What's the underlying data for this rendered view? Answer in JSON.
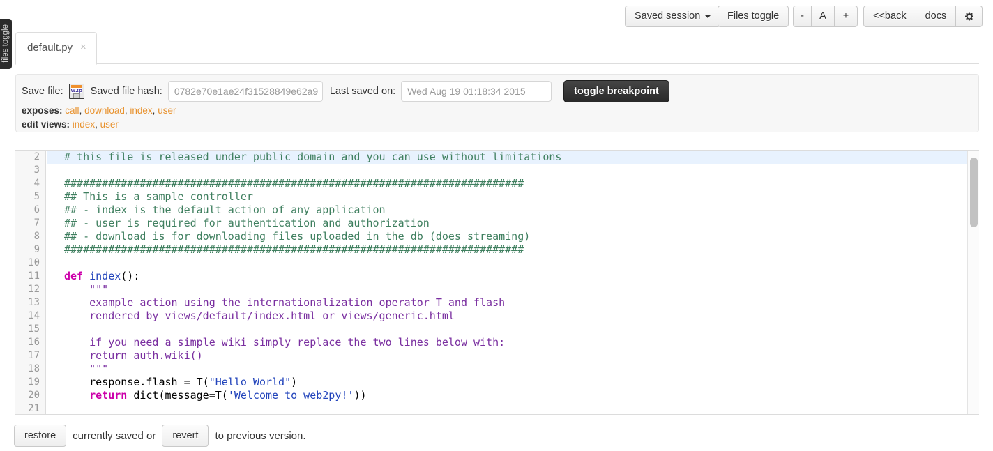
{
  "toolbar": {
    "saved_session": "Saved session",
    "files_toggle": "Files toggle",
    "zoom_out": "-",
    "font": "A",
    "zoom_in": "+",
    "back": "<<back",
    "docs": "docs",
    "settings_icon": "gear-icon"
  },
  "sidebar": {
    "files_toggle_label": "files toggle"
  },
  "tabs": [
    {
      "label": "default.py",
      "close": "×",
      "active": true
    }
  ],
  "info": {
    "save_file_label": "Save file:",
    "save_icon": "floppy-disk-icon",
    "save_icon_text": "w2p",
    "hash_label": "Saved file hash:",
    "hash_value": "0782e70e1ae24f31528849e62a9",
    "last_saved_label": "Last saved on:",
    "last_saved_value": "Wed Aug 19 01:18:34 2015",
    "toggle_breakpoint": "toggle breakpoint",
    "exposes_label": "exposes:",
    "exposes_links": [
      "call",
      "download",
      "index",
      "user"
    ],
    "edit_views_label": "edit views:",
    "edit_views_links": [
      "index",
      "user"
    ]
  },
  "editor": {
    "first_line_number": 2,
    "lines": [
      {
        "n": 2,
        "active": true,
        "clipped": true,
        "tokens": [
          {
            "t": "comment",
            "s": "# this file is released under public domain and you can use without limitations"
          }
        ]
      },
      {
        "n": 3,
        "tokens": []
      },
      {
        "n": 4,
        "tokens": [
          {
            "t": "comment",
            "s": "#########################################################################"
          }
        ]
      },
      {
        "n": 5,
        "tokens": [
          {
            "t": "comment",
            "s": "## This is a sample controller"
          }
        ]
      },
      {
        "n": 6,
        "tokens": [
          {
            "t": "comment",
            "s": "## - index is the default action of any application"
          }
        ]
      },
      {
        "n": 7,
        "tokens": [
          {
            "t": "comment",
            "s": "## - user is required for authentication and authorization"
          }
        ]
      },
      {
        "n": 8,
        "tokens": [
          {
            "t": "comment",
            "s": "## - download is for downloading files uploaded in the db (does streaming)"
          }
        ]
      },
      {
        "n": 9,
        "tokens": [
          {
            "t": "comment",
            "s": "#########################################################################"
          }
        ]
      },
      {
        "n": 10,
        "tokens": []
      },
      {
        "n": 11,
        "tokens": [
          {
            "t": "kw",
            "s": "def"
          },
          {
            "t": "plain",
            "s": " "
          },
          {
            "t": "fn",
            "s": "index"
          },
          {
            "t": "plain",
            "s": "():"
          }
        ]
      },
      {
        "n": 12,
        "tokens": [
          {
            "t": "doc",
            "s": "    \"\"\""
          }
        ]
      },
      {
        "n": 13,
        "tokens": [
          {
            "t": "doc",
            "s": "    example action using the internationalization operator T and flash"
          }
        ]
      },
      {
        "n": 14,
        "tokens": [
          {
            "t": "doc",
            "s": "    rendered by views/default/index.html or views/generic.html"
          }
        ]
      },
      {
        "n": 15,
        "tokens": []
      },
      {
        "n": 16,
        "tokens": [
          {
            "t": "doc",
            "s": "    if you need a simple wiki simply replace the two lines below with:"
          }
        ]
      },
      {
        "n": 17,
        "tokens": [
          {
            "t": "doc",
            "s": "    return auth.wiki()"
          }
        ]
      },
      {
        "n": 18,
        "tokens": [
          {
            "t": "doc",
            "s": "    \"\"\""
          }
        ]
      },
      {
        "n": 19,
        "tokens": [
          {
            "t": "plain",
            "s": "    response.flash = T("
          },
          {
            "t": "str",
            "s": "\"Hello World\""
          },
          {
            "t": "plain",
            "s": ")"
          }
        ]
      },
      {
        "n": 20,
        "tokens": [
          {
            "t": "kw",
            "s": "    return"
          },
          {
            "t": "plain",
            "s": " dict(message=T("
          },
          {
            "t": "str",
            "s": "'Welcome to web2py!'"
          },
          {
            "t": "plain",
            "s": "))"
          }
        ]
      },
      {
        "n": 21,
        "clipped_bottom": true,
        "tokens": []
      }
    ]
  },
  "bottom": {
    "restore": "restore",
    "text_1": "currently saved or",
    "revert": "revert",
    "text_2": "to previous version."
  },
  "colors": {
    "accent_link": "#e8922e",
    "comment": "#3f7f5f",
    "keyword": "#cc00aa",
    "string": "#2244bb",
    "docstring": "#7a2fa0",
    "active_line": "#e8f2fe",
    "dark_button": "#2a2a2a"
  }
}
